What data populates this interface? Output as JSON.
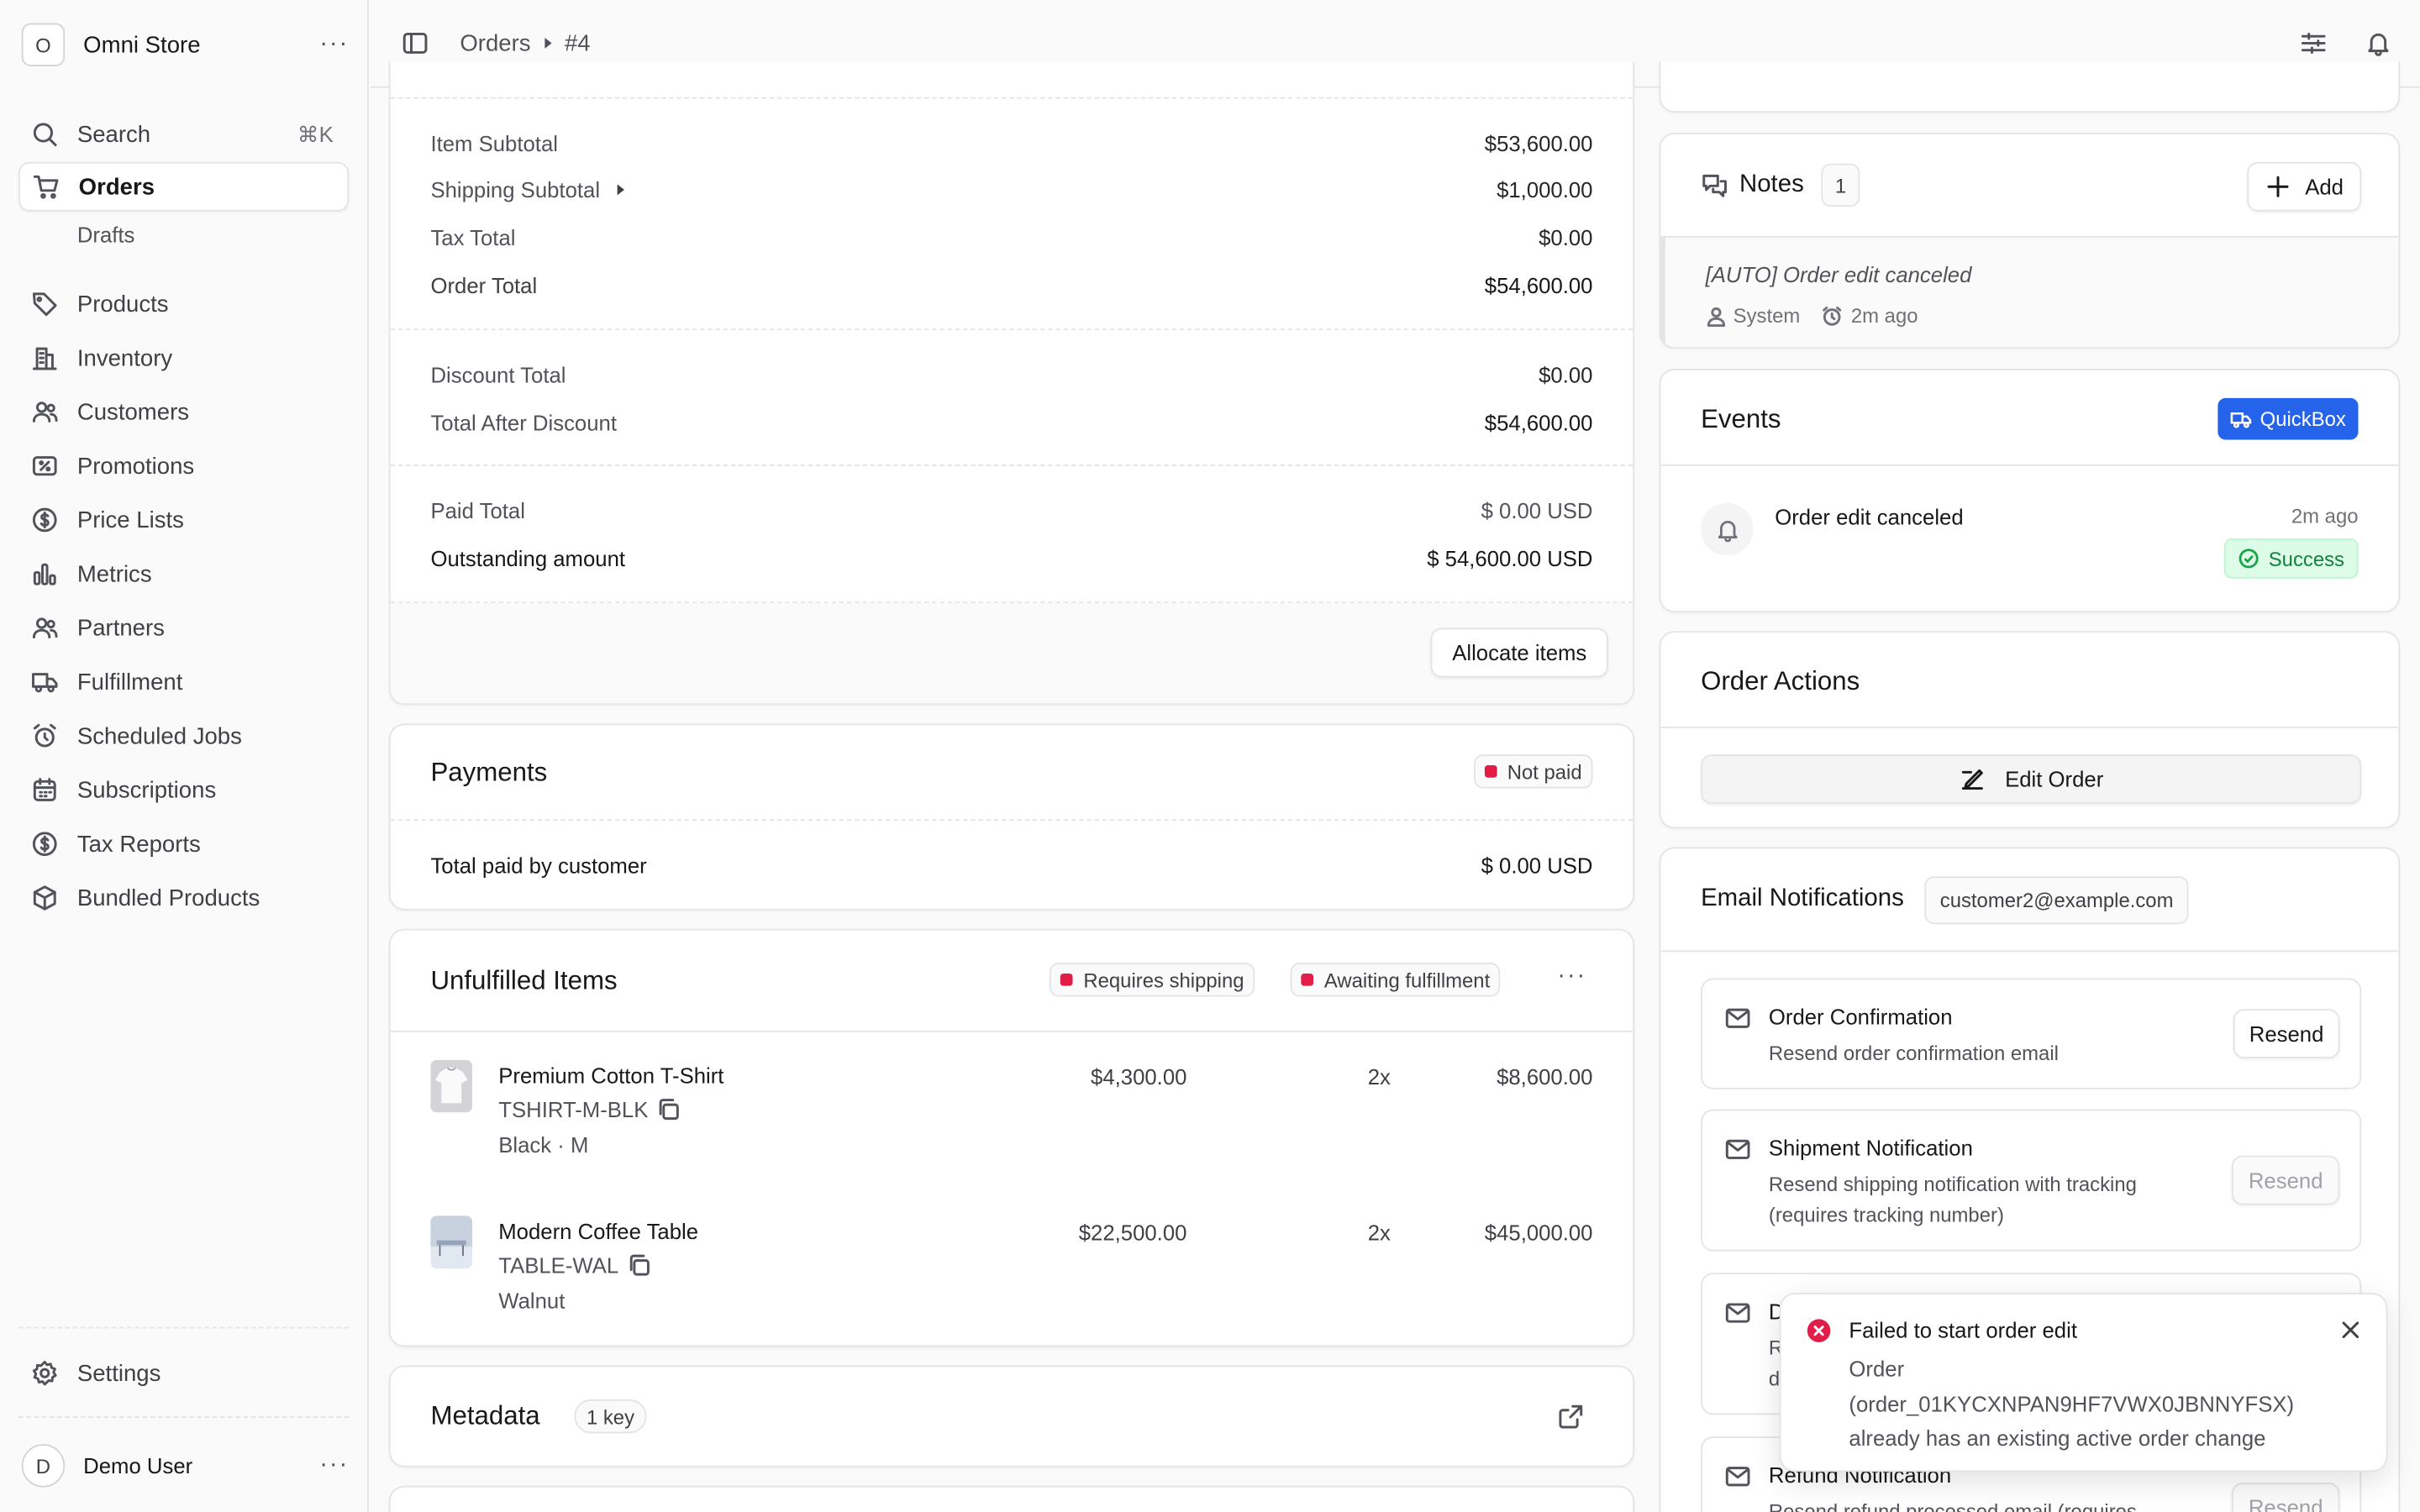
{
  "sidebar": {
    "store_initial": "O",
    "store_name": "Omni Store",
    "search_label": "Search",
    "search_shortcut": "⌘K",
    "items": [
      {
        "label": "Orders",
        "icon": "cart-icon",
        "active": true
      },
      {
        "label": "Products",
        "icon": "tag-icon"
      },
      {
        "label": "Inventory",
        "icon": "building-icon"
      },
      {
        "label": "Customers",
        "icon": "users-icon"
      },
      {
        "label": "Promotions",
        "icon": "receipt-percent-icon"
      },
      {
        "label": "Price Lists",
        "icon": "currency-dollar-icon"
      },
      {
        "label": "Metrics",
        "icon": "chart-bar-icon"
      },
      {
        "label": "Partners",
        "icon": "users-icon"
      },
      {
        "label": "Fulfillment",
        "icon": "truck-icon"
      },
      {
        "label": "Scheduled Jobs",
        "icon": "alarm-clock-icon"
      },
      {
        "label": "Subscriptions",
        "icon": "calendar-icon"
      },
      {
        "label": "Tax Reports",
        "icon": "currency-dollar-icon"
      },
      {
        "label": "Bundled Products",
        "icon": "cube-icon"
      }
    ],
    "drafts_label": "Drafts",
    "settings_label": "Settings",
    "user_initial": "D",
    "user_name": "Demo User"
  },
  "header": {
    "breadcrumb_root": "Orders",
    "breadcrumb_current": "#4"
  },
  "summary": {
    "item_subtotal_label": "Item Subtotal",
    "item_subtotal": "$53,600.00",
    "shipping_subtotal_label": "Shipping Subtotal",
    "shipping_subtotal": "$1,000.00",
    "tax_total_label": "Tax Total",
    "tax_total": "$0.00",
    "order_total_label": "Order Total",
    "order_total": "$54,600.00",
    "discount_total_label": "Discount Total",
    "discount_total": "$0.00",
    "total_after_discount_label": "Total After Discount",
    "total_after_discount": "$54,600.00",
    "paid_total_label": "Paid Total",
    "paid_total": "$ 0.00 USD",
    "outstanding_label": "Outstanding amount",
    "outstanding": "$ 54,600.00 USD",
    "allocate_button": "Allocate items"
  },
  "payments": {
    "title": "Payments",
    "status": "Not paid",
    "total_paid_label": "Total paid by customer",
    "total_paid": "$ 0.00 USD"
  },
  "unfulfilled": {
    "title": "Unfulfilled Items",
    "badge_shipping": "Requires shipping",
    "badge_fulfillment": "Awaiting fulfillment",
    "items": [
      {
        "name": "Premium Cotton T-Shirt",
        "sku": "TSHIRT-M-BLK",
        "variant": "Black · M",
        "price": "$4,300.00",
        "qty": "2x",
        "total": "$8,600.00"
      },
      {
        "name": "Modern Coffee Table",
        "sku": "TABLE-WAL",
        "variant": "Walnut",
        "price": "$22,500.00",
        "qty": "2x",
        "total": "$45,000.00"
      }
    ]
  },
  "metadata": {
    "title": "Metadata",
    "count": "1 key"
  },
  "notes": {
    "title": "Notes",
    "count": "1",
    "add_button": "Add",
    "note_text": "[AUTO] Order edit canceled",
    "note_author": "System",
    "note_time": "2m ago"
  },
  "events": {
    "title": "Events",
    "badge": "QuickBox",
    "event_title": "Order edit canceled",
    "event_time": "2m ago",
    "event_status": "Success"
  },
  "order_actions": {
    "title": "Order Actions",
    "edit_button": "Edit Order"
  },
  "email": {
    "title": "Email Notifications",
    "address": "customer2@example.com",
    "items": [
      {
        "title": "Order Confirmation",
        "desc": "Resend order confirmation email",
        "button": "Resend"
      },
      {
        "title": "Shipment Notification",
        "desc": "Resend shipping notification with tracking (requires tracking number)",
        "button": "Resend"
      },
      {
        "title": "D",
        "desc": "R",
        "desc2": "d"
      },
      {
        "title": "Refund Notification",
        "desc": "Resend refund processed email (requires",
        "button": "Resend"
      }
    ]
  },
  "toast": {
    "title": "Failed to start order edit",
    "message_line1": "Order",
    "message_line2": "(order_01KYCXNPAN9HF7VWX0JBNNYFSX)",
    "message_line3": "already has an existing active order change"
  },
  "colors": {
    "accent_blue": "#2563eb",
    "danger": "#e11d48",
    "success_bg": "#dcfce7",
    "success_text": "#15803d"
  }
}
